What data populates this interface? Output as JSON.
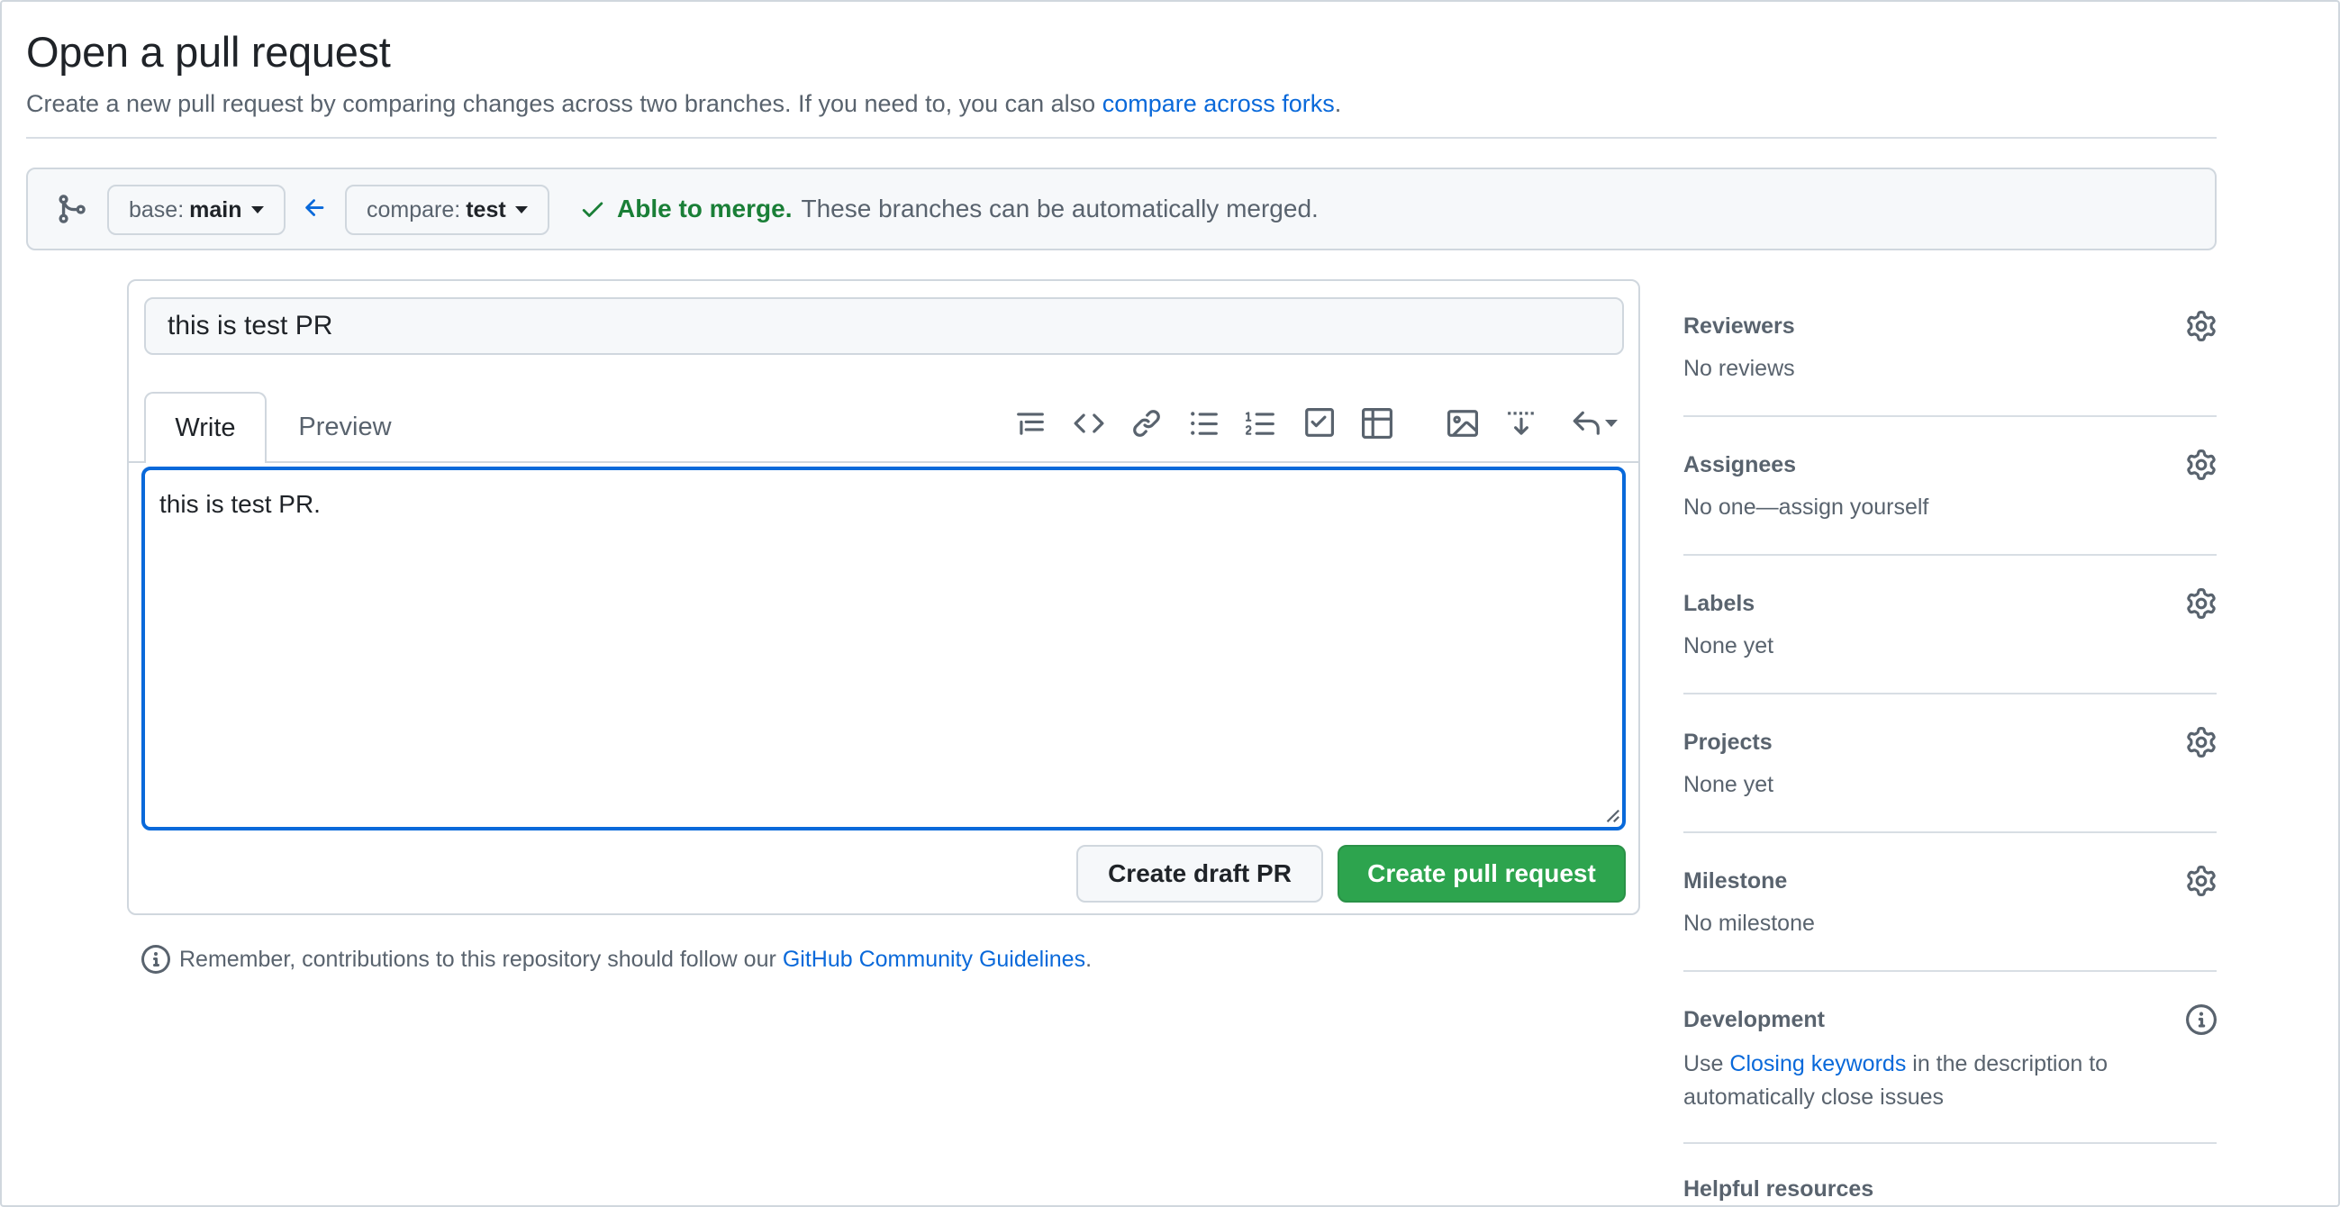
{
  "page": {
    "title": "Open a pull request",
    "subtitle": "Create a new pull request by comparing changes across two branches. If you need to, you can also ",
    "subtitle_link": "compare across forks",
    "subtitle_end": "."
  },
  "range": {
    "base_label": "base:",
    "base_branch": "main",
    "compare_label": "compare:",
    "compare_branch": "test",
    "merge_ok": "Able to merge.",
    "merge_msg": "These branches can be automatically merged."
  },
  "form": {
    "title_value": "this is test PR",
    "tabs": [
      {
        "label": "Write",
        "active": true
      },
      {
        "label": "Preview",
        "active": false
      }
    ],
    "body_value": "this is test PR.",
    "toolbar_icons": [
      "heading-icon",
      "code-icon",
      "link-icon",
      "unordered-list-icon",
      "ordered-list-icon",
      "task-list-icon",
      "table-icon",
      "image-icon",
      "details-icon",
      "undo-icon"
    ],
    "draft_button": "Create draft PR",
    "create_button": "Create pull request"
  },
  "reminder": {
    "text": "Remember, contributions to this repository should follow our ",
    "link": "GitHub Community Guidelines",
    "end": "."
  },
  "sidebar": {
    "reviewers": {
      "heading": "Reviewers",
      "value": "No reviews"
    },
    "assignees": {
      "heading": "Assignees",
      "value": "No one—assign yourself"
    },
    "labels": {
      "heading": "Labels",
      "value": "None yet"
    },
    "projects": {
      "heading": "Projects",
      "value": "None yet"
    },
    "milestone": {
      "heading": "Milestone",
      "value": "No milestone"
    },
    "development": {
      "heading": "Development",
      "value_pre": "Use ",
      "value_link": "Closing keywords",
      "value_post": " in the description to automatically close issues"
    },
    "helpful": {
      "heading": "Helpful resources"
    }
  },
  "colors": {
    "accent": "#0969da",
    "success": "#1a7f37",
    "primary_button": "#2da44e"
  }
}
